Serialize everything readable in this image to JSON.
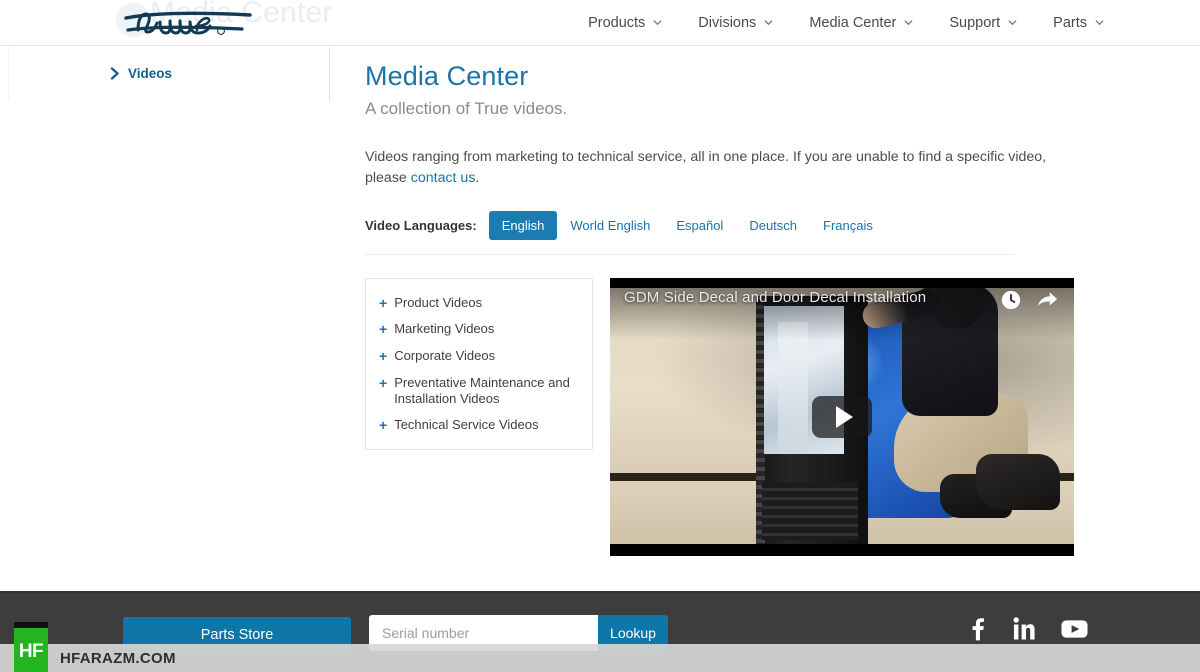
{
  "header": {
    "logo_alt": "true",
    "ghost_text": "Media Center",
    "nav": [
      {
        "label": "Products",
        "icon": "chevron-down-icon"
      },
      {
        "label": "Divisions",
        "icon": "chevron-down-icon"
      },
      {
        "label": "Media Center",
        "icon": "chevron-down-icon"
      },
      {
        "label": "Support",
        "icon": "chevron-down-icon"
      },
      {
        "label": "Parts",
        "icon": "chevron-down-icon"
      }
    ]
  },
  "sidebar": {
    "items": [
      {
        "label": "Videos",
        "icon": "chevron-right-icon"
      }
    ]
  },
  "main": {
    "title": "Media Center",
    "subtitle": "A collection of True videos.",
    "intro_text_before": "Videos ranging from marketing to technical service, all in one place. If you are unable to find a specific video, please ",
    "intro_link": "contact us",
    "intro_text_after": ".",
    "languages": {
      "label": "Video Languages:",
      "options": [
        {
          "label": "English",
          "active": true
        },
        {
          "label": "World English",
          "active": false
        },
        {
          "label": "Español",
          "active": false
        },
        {
          "label": "Deutsch",
          "active": false
        },
        {
          "label": "Français",
          "active": false
        }
      ]
    },
    "accordion": {
      "items": [
        {
          "icon": "plus-icon",
          "label": "Product Videos"
        },
        {
          "icon": "plus-icon",
          "label": "Marketing Videos"
        },
        {
          "icon": "plus-icon",
          "label": "Corporate Videos"
        },
        {
          "icon": "plus-icon",
          "label": "Preventative Maintenance and Installation Videos"
        },
        {
          "icon": "plus-icon",
          "label": "Technical Service Videos"
        }
      ]
    },
    "video": {
      "title": "GDM Side Decal and Door Decal Installation",
      "watch_later_icon": "clock-icon",
      "share_icon": "share-arrow-icon",
      "play_icon": "play-icon"
    }
  },
  "footer": {
    "parts_store_label": "Parts Store",
    "serial_placeholder": "Serial number",
    "serial_value": "",
    "lookup_label": "Lookup",
    "socials": [
      {
        "name": "facebook-icon",
        "label": "f"
      },
      {
        "name": "linkedin-icon",
        "label": "in"
      },
      {
        "name": "youtube-icon",
        "label": ""
      }
    ]
  },
  "watermark": {
    "badge": "HF",
    "text": "HFARAZM.COM"
  },
  "colors": {
    "brand_blue": "#1a74a8",
    "accent_blue": "#0e76a8",
    "active_tab": "#1a7cb0",
    "footer_bg": "#3d3d3d",
    "logo_navy": "#123a52",
    "watermark_green": "#22b51f"
  }
}
